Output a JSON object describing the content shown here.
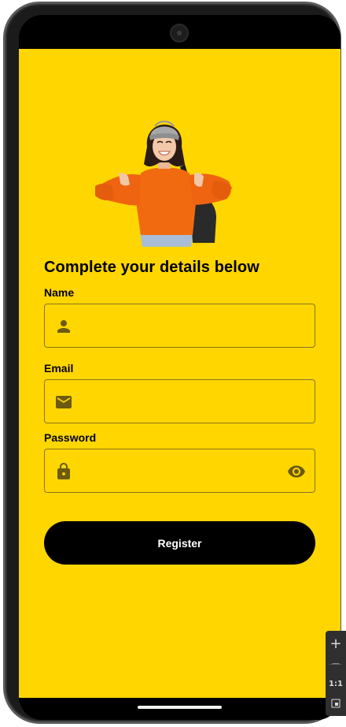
{
  "form": {
    "title": "Complete your details below",
    "name_label": "Name",
    "email_label": "Email",
    "password_label": "Password",
    "name_value": "",
    "email_value": "",
    "password_value": "",
    "register_label": "Register"
  },
  "icons": {
    "name": "person-icon",
    "email": "mail-icon",
    "password": "lock-icon",
    "toggle": "eye-icon"
  },
  "colors": {
    "background": "#FFD600",
    "button": "#000000",
    "button_text": "#FFFFFF",
    "icon": "#6B5A10"
  },
  "emulator_toolbar": {
    "zoom_in": "+",
    "minus": "−",
    "actual_size": "1:1"
  }
}
